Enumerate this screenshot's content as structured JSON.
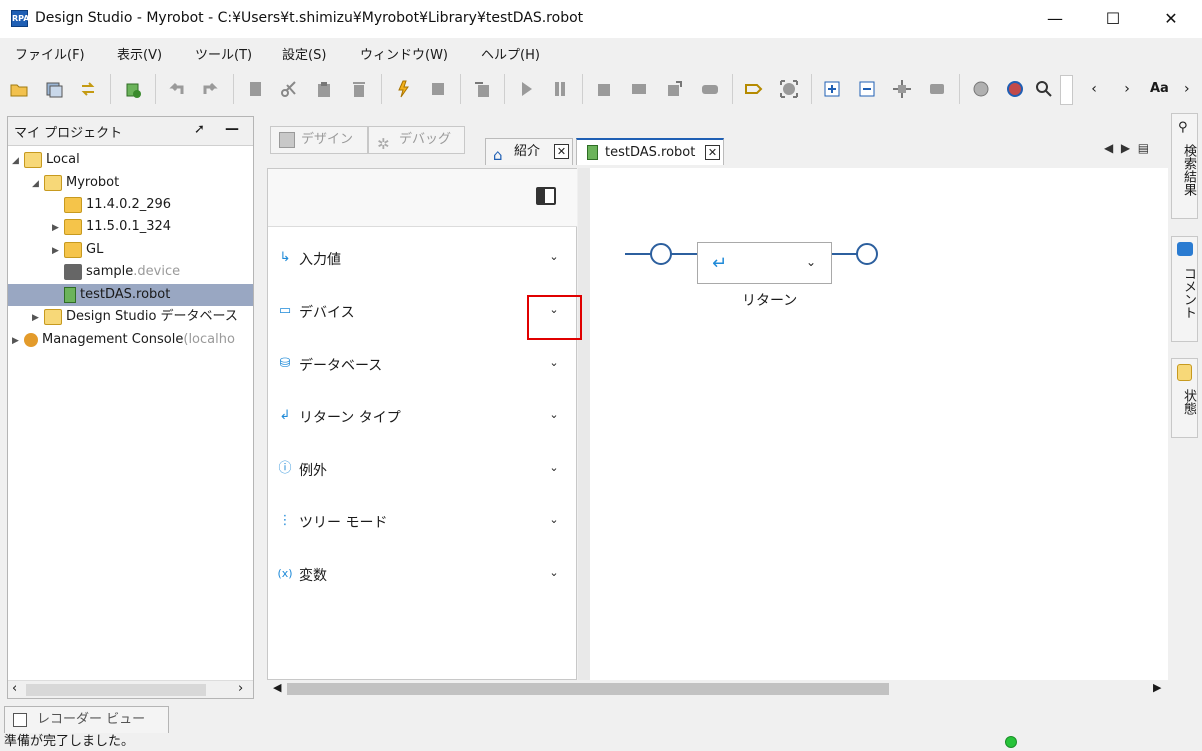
{
  "window": {
    "title": "Design Studio - Myrobot - C:¥Users¥t.shimizu¥Myrobot¥Library¥testDAS.robot",
    "minimize_icon": "minimize-icon",
    "maximize_icon": "maximize-icon",
    "close_icon": "close-icon"
  },
  "menu": [
    "ファイル(F)",
    "表示(V)",
    "ツール(T)",
    "設定(S)",
    "ウィンドウ(W)",
    "ヘルプ(H)"
  ],
  "toolbar": {
    "icons": [
      "open-folder-icon",
      "save-all-icon",
      "refresh-icon",
      "add-robot-icon",
      "undo-icon",
      "redo-icon",
      "copy-icon",
      "cut-icon",
      "paste-icon",
      "delete-icon",
      "bulb-icon",
      "stop-icon",
      "step-into-icon",
      "play-icon",
      "pause-icon",
      "step-1-icon",
      "step-2-icon",
      "step-3-icon",
      "step-4-icon",
      "tag-icon",
      "focus-icon",
      "expand-icon",
      "collapse-icon",
      "node-icon",
      "device-icon",
      "globe-icon",
      "globe-user-icon",
      "search-icon",
      "prev-icon",
      "next-icon",
      "font-icon",
      "more-icon"
    ],
    "font_label": "Aa"
  },
  "project_panel": {
    "title": "マイ プロジェクト",
    "tree": [
      {
        "label": "Local",
        "suffix": ""
      },
      {
        "label": "Myrobot",
        "suffix": ""
      },
      {
        "label": "11.4.0.2_296",
        "suffix": ""
      },
      {
        "label": "11.5.0.1_324",
        "suffix": ""
      },
      {
        "label": "GL",
        "suffix": ""
      },
      {
        "label": "sample",
        "suffix": ".device"
      },
      {
        "label": "testDAS.robot",
        "suffix": ""
      },
      {
        "label": "Design Studio データベース",
        "suffix": ""
      },
      {
        "label": "Management Console",
        "suffix": "(localho"
      }
    ]
  },
  "mode_tabs": {
    "design": "デザイン",
    "debug": "デバッグ"
  },
  "editor_tabs": [
    {
      "label": "紹介",
      "close": "✕"
    },
    {
      "label": "testDAS.robot",
      "close": "✕"
    }
  ],
  "steps": [
    {
      "label": "入力値",
      "icon": "input-arrow-icon"
    },
    {
      "label": "デバイス",
      "icon": "monitor-icon"
    },
    {
      "label": "データベース",
      "icon": "database-icon"
    },
    {
      "label": "リターン タイプ",
      "icon": "return-icon"
    },
    {
      "label": "例外",
      "icon": "exception-icon"
    },
    {
      "label": "ツリー モード",
      "icon": "tree-mode-icon"
    },
    {
      "label": "変数",
      "icon": "variables-icon"
    }
  ],
  "canvas": {
    "return_step_label": "リターン"
  },
  "side_panels": [
    "検索結果",
    "コメント",
    "状態"
  ],
  "bottom": {
    "recorder_tab": "レコーダー ビュー",
    "status": "準備が完了しました。"
  },
  "colors": {
    "accent": "#1f5fb4",
    "flow": "#2c5f9e",
    "highlight": "#e00000",
    "status_ok": "#27c33a"
  }
}
